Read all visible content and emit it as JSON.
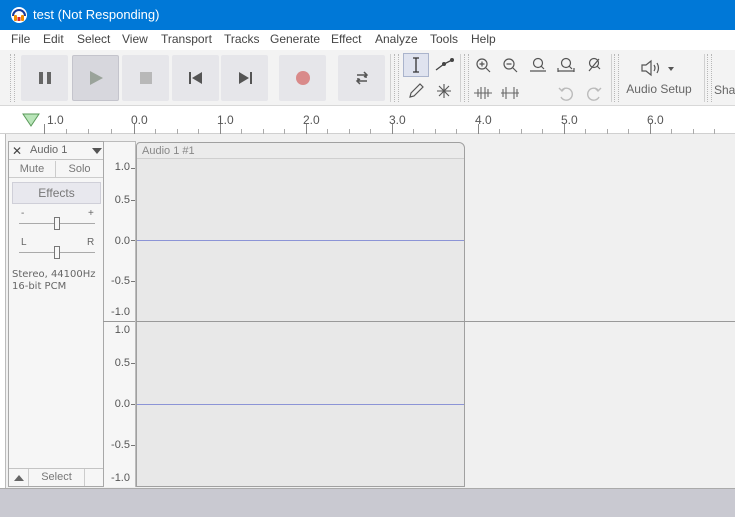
{
  "window": {
    "title": "test (Not Responding)"
  },
  "menu": [
    "File",
    "Edit",
    "Select",
    "View",
    "Transport",
    "Tracks",
    "Generate",
    "Effect",
    "Analyze",
    "Tools",
    "Help"
  ],
  "toolbar": {
    "transport_icons": [
      "pause-icon",
      "play-icon",
      "stop-icon",
      "skip-to-start-icon",
      "skip-to-end-icon",
      "record-icon",
      "loop-icon"
    ],
    "audio_setup_label": "Audio Setup",
    "share_label": "Sha"
  },
  "ruler": {
    "labels": [
      "1.0",
      "0.0",
      "1.0",
      "2.0",
      "3.0",
      "4.0",
      "5.0",
      "6.0"
    ]
  },
  "track": {
    "name": "Audio 1",
    "mute_label": "Mute",
    "solo_label": "Solo",
    "effects_label": "Effects",
    "gain_minus": "-",
    "gain_plus": "+",
    "pan_left": "L",
    "pan_right": "R",
    "format_line1": "Stereo, 44100Hz",
    "format_line2": "16-bit PCM",
    "select_label": "Select"
  },
  "clip": {
    "name": "Audio 1 #1"
  },
  "vruler": {
    "top_channel": [
      "1.0",
      "0.5",
      "0.0",
      "-0.5",
      "-1.0"
    ],
    "bottom_channel": [
      "1.0",
      "0.5",
      "0.0",
      "-0.5",
      "-1.0"
    ]
  },
  "colors": {
    "titlebar": "#0078d7",
    "record": "#d9534f",
    "waveform_zero": "#8c94d6"
  }
}
